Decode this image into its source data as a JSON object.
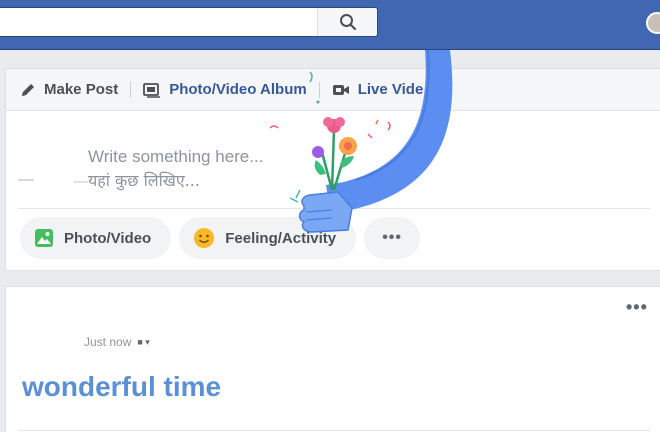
{
  "topbar": {
    "search": {
      "placeholder": "",
      "button_icon": "search-icon"
    },
    "brand_color": "#4267b2"
  },
  "composer": {
    "tabs": [
      {
        "label": "Make Post",
        "icon": "pencil-icon"
      },
      {
        "label": "Photo/Video Album",
        "icon": "album-icon"
      },
      {
        "label": "Live Vide",
        "icon": "video-camera-icon"
      }
    ],
    "placeholder_en": "Write something here...",
    "placeholder_hi": "यहां कुछ लिखिए...",
    "actions": [
      {
        "label": "Photo/Video",
        "icon": "photo-icon"
      },
      {
        "label": "Feeling/Activity",
        "icon": "smiley-icon"
      },
      {
        "label": "",
        "icon": "more-icon"
      }
    ]
  },
  "post": {
    "timestamp": "Just now",
    "privacy_icon": "audience-icon",
    "text": "wonderful time",
    "menu_icon": "ellipsis-icon"
  },
  "colors": {
    "post_text": "#5b8fd6",
    "sticker_arm": "#5b8ef0",
    "sticker_hand": "#7aa8f5"
  }
}
